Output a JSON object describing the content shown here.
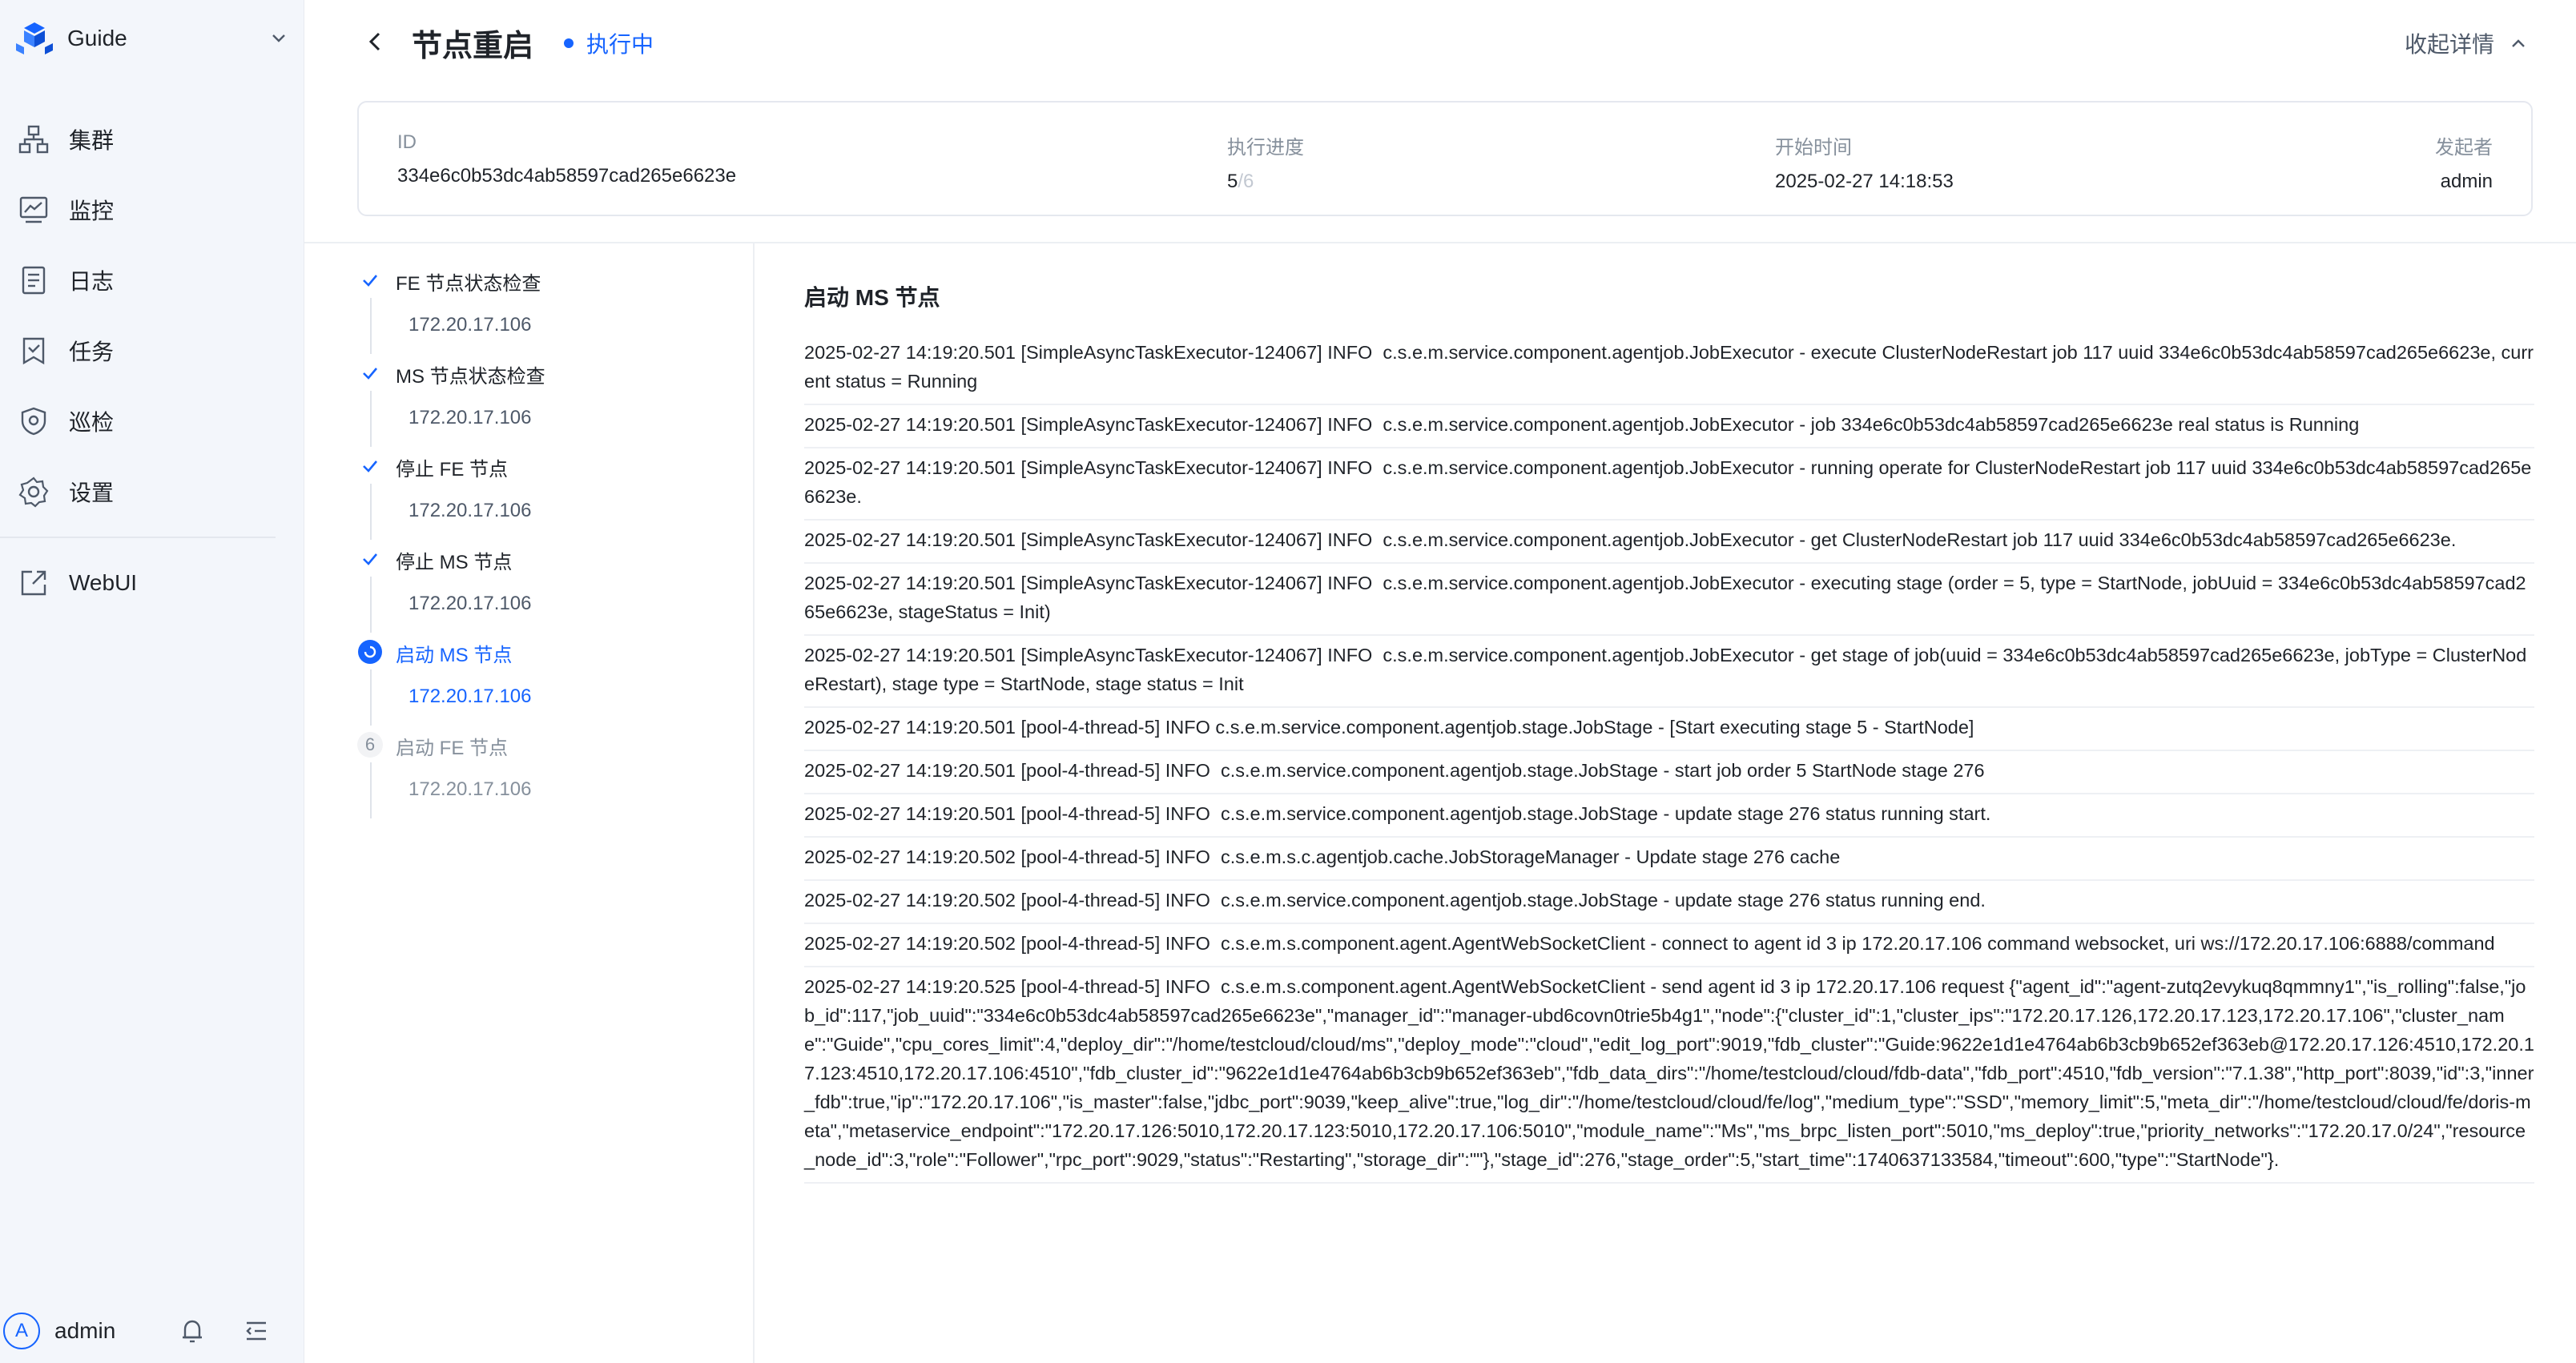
{
  "sidebar": {
    "brand": "Guide",
    "items": [
      {
        "label": "集群",
        "icon": "cluster-icon"
      },
      {
        "label": "监控",
        "icon": "monitor-icon"
      },
      {
        "label": "日志",
        "icon": "log-icon"
      },
      {
        "label": "任务",
        "icon": "task-icon"
      },
      {
        "label": "巡检",
        "icon": "inspection-icon"
      },
      {
        "label": "设置",
        "icon": "settings-icon"
      }
    ],
    "webui": {
      "label": "WebUI",
      "icon": "external-link-icon"
    },
    "user": {
      "avatar_letter": "A",
      "name": "admin"
    }
  },
  "header": {
    "title": "节点重启",
    "status": "执行中",
    "collapse_label": "收起详情",
    "accent_color": "#1664ff"
  },
  "info": {
    "id_label": "ID",
    "id_value": "334e6c0b53dc4ab58597cad265e6623e",
    "progress_label": "执行进度",
    "progress_done": "5",
    "progress_sep": "/",
    "progress_total": "6",
    "start_label": "开始时间",
    "start_value": "2025-02-27 14:18:53",
    "initiator_label": "发起者",
    "initiator_value": "admin"
  },
  "steps": [
    {
      "name": "FE 节点状态检查",
      "ip": "172.20.17.106",
      "state": "done"
    },
    {
      "name": "MS 节点状态检查",
      "ip": "172.20.17.106",
      "state": "done"
    },
    {
      "name": "停止 FE 节点",
      "ip": "172.20.17.106",
      "state": "done"
    },
    {
      "name": "停止 MS 节点",
      "ip": "172.20.17.106",
      "state": "done"
    },
    {
      "name": "启动 MS 节点",
      "ip": "172.20.17.106",
      "state": "active"
    },
    {
      "name": "启动 FE 节点",
      "ip": "172.20.17.106",
      "state": "pending",
      "number": "6"
    }
  ],
  "log": {
    "title": "启动 MS 节点",
    "lines": [
      "2025-02-27 14:19:20.501 [SimpleAsyncTaskExecutor-124067] INFO  c.s.e.m.service.component.agentjob.JobExecutor - execute ClusterNodeRestart job 117 uuid 334e6c0b53dc4ab58597cad265e6623e, current status = Running",
      "2025-02-27 14:19:20.501 [SimpleAsyncTaskExecutor-124067] INFO  c.s.e.m.service.component.agentjob.JobExecutor - job 334e6c0b53dc4ab58597cad265e6623e real status is Running",
      "2025-02-27 14:19:20.501 [SimpleAsyncTaskExecutor-124067] INFO  c.s.e.m.service.component.agentjob.JobExecutor - running operate for ClusterNodeRestart job 117 uuid 334e6c0b53dc4ab58597cad265e6623e.",
      "2025-02-27 14:19:20.501 [SimpleAsyncTaskExecutor-124067] INFO  c.s.e.m.service.component.agentjob.JobExecutor - get ClusterNodeRestart job 117 uuid 334e6c0b53dc4ab58597cad265e6623e.",
      "2025-02-27 14:19:20.501 [SimpleAsyncTaskExecutor-124067] INFO  c.s.e.m.service.component.agentjob.JobExecutor - executing stage (order = 5, type = StartNode, jobUuid = 334e6c0b53dc4ab58597cad265e6623e, stageStatus = Init)",
      "2025-02-27 14:19:20.501 [SimpleAsyncTaskExecutor-124067] INFO  c.s.e.m.service.component.agentjob.JobExecutor - get stage of job(uuid = 334e6c0b53dc4ab58597cad265e6623e, jobType = ClusterNodeRestart), stage type = StartNode, stage status = Init",
      "2025-02-27 14:19:20.501 [pool-4-thread-5] INFO c.s.e.m.service.component.agentjob.stage.JobStage - [Start executing stage 5 - StartNode]",
      "2025-02-27 14:19:20.501 [pool-4-thread-5] INFO  c.s.e.m.service.component.agentjob.stage.JobStage - start job order 5 StartNode stage 276",
      "2025-02-27 14:19:20.501 [pool-4-thread-5] INFO  c.s.e.m.service.component.agentjob.stage.JobStage - update stage 276 status running start.",
      "2025-02-27 14:19:20.502 [pool-4-thread-5] INFO  c.s.e.m.s.c.agentjob.cache.JobStorageManager - Update stage 276 cache",
      "2025-02-27 14:19:20.502 [pool-4-thread-5] INFO  c.s.e.m.service.component.agentjob.stage.JobStage - update stage 276 status running end.",
      "2025-02-27 14:19:20.502 [pool-4-thread-5] INFO  c.s.e.m.s.component.agent.AgentWebSocketClient - connect to agent id 3 ip 172.20.17.106 command websocket, uri ws://172.20.17.106:6888/command",
      "2025-02-27 14:19:20.525 [pool-4-thread-5] INFO  c.s.e.m.s.component.agent.AgentWebSocketClient - send agent id 3 ip 172.20.17.106 request {\"agent_id\":\"agent-zutq2evykuq8qmmny1\",\"is_rolling\":false,\"job_id\":117,\"job_uuid\":\"334e6c0b53dc4ab58597cad265e6623e\",\"manager_id\":\"manager-ubd6covn0trie5b4g1\",\"node\":{\"cluster_id\":1,\"cluster_ips\":\"172.20.17.126,172.20.17.123,172.20.17.106\",\"cluster_name\":\"Guide\",\"cpu_cores_limit\":4,\"deploy_dir\":\"/home/testcloud/cloud/ms\",\"deploy_mode\":\"cloud\",\"edit_log_port\":9019,\"fdb_cluster\":\"Guide:9622e1d1e4764ab6b3cb9b652ef363eb@172.20.17.126:4510,172.20.17.123:4510,172.20.17.106:4510\",\"fdb_cluster_id\":\"9622e1d1e4764ab6b3cb9b652ef363eb\",\"fdb_data_dirs\":\"/home/testcloud/cloud/fdb-data\",\"fdb_port\":4510,\"fdb_version\":\"7.1.38\",\"http_port\":8039,\"id\":3,\"inner_fdb\":true,\"ip\":\"172.20.17.106\",\"is_master\":false,\"jdbc_port\":9039,\"keep_alive\":true,\"log_dir\":\"/home/testcloud/cloud/fe/log\",\"medium_type\":\"SSD\",\"memory_limit\":5,\"meta_dir\":\"/home/testcloud/cloud/fe/doris-meta\",\"metaservice_endpoint\":\"172.20.17.126:5010,172.20.17.123:5010,172.20.17.106:5010\",\"module_name\":\"Ms\",\"ms_brpc_listen_port\":5010,\"ms_deploy\":true,\"priority_networks\":\"172.20.17.0/24\",\"resource_node_id\":3,\"role\":\"Follower\",\"rpc_port\":9029,\"status\":\"Restarting\",\"storage_dir\":\"\"},\"stage_id\":276,\"stage_order\":5,\"start_time\":1740637133584,\"timeout\":600,\"type\":\"StartNode\"}."
    ]
  }
}
